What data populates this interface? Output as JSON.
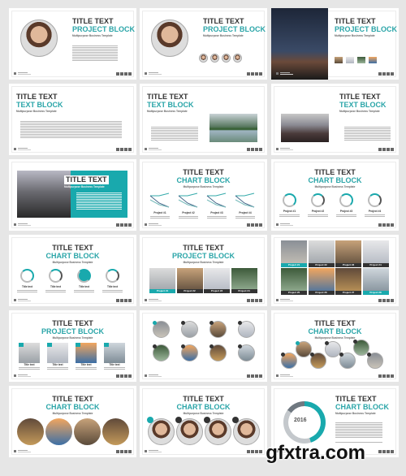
{
  "slides": [
    {
      "title": "TITLE TEXT",
      "subtitle": "PROJECT BLOCK",
      "tagline": "Multipurpose Business Template"
    },
    {
      "title": "TITLE TEXT",
      "subtitle": "PROJECT BLOCK",
      "tagline": "Multipurpose Business Template"
    },
    {
      "title": "TITLE TEXT",
      "subtitle": "PROJECT BLOCK",
      "tagline": "Multipurpose Business Template"
    },
    {
      "title": "TITLE TEXT",
      "subtitle": "TEXT BLOCK",
      "tagline": "Multipurpose Business Template"
    },
    {
      "title": "TITLE TEXT",
      "subtitle": "TEXT BLOCK",
      "tagline": "Multipurpose Business Template"
    },
    {
      "title": "TITLE TEXT",
      "subtitle": "TEXT BLOCK",
      "tagline": "Multipurpose Business Template"
    },
    {
      "title": "TITLE TEXT",
      "tagline": "Multipurpose Business Template"
    },
    {
      "title": "TITLE TEXT",
      "subtitle": "CHART BLOCK",
      "tagline": "Multipurpose Business Template",
      "items": [
        "Project #1",
        "Project #2",
        "Project #3",
        "Project #4"
      ]
    },
    {
      "title": "TITLE TEXT",
      "subtitle": "CHART BLOCK",
      "tagline": "Multipurpose Business Template",
      "items": [
        "Project #1",
        "Project #2",
        "Project #3",
        "Project #4"
      ]
    },
    {
      "title": "TITLE TEXT",
      "subtitle": "CHART BLOCK",
      "tagline": "Multipurpose Business Template",
      "items": [
        "Title text",
        "Title text",
        "Title text",
        "Title text"
      ]
    },
    {
      "title": "TITLE TEXT",
      "subtitle": "PROJECT BLOCK",
      "tagline": "Multipurpose Business Template",
      "items": [
        "Project #1",
        "Project #2",
        "Project #3",
        "Project #4"
      ]
    },
    {
      "items": [
        "Project #1",
        "Project #2",
        "Project #3",
        "Project #4",
        "Project #5",
        "Project #6",
        "Project #7",
        "Project #8"
      ]
    },
    {
      "title": "TITLE TEXT",
      "subtitle": "PROJECT BLOCK",
      "tagline": "Multipurpose Business Template",
      "items": [
        "Title text",
        "Title text",
        "Title text",
        "Title text"
      ]
    },
    {},
    {
      "title": "TITLE TEXT",
      "subtitle": "CHART BLOCK",
      "tagline": "Multipurpose Business Template"
    },
    {
      "title": "TITLE TEXT",
      "subtitle": "CHART BLOCK",
      "tagline": "Multipurpose Business Template"
    },
    {
      "title": "TITLE TEXT",
      "subtitle": "CHART BLOCK",
      "tagline": "Multipurpose Business Template"
    },
    {
      "title": "TITLE TEXT",
      "subtitle": "CHART BLOCK",
      "tagline": "Multipurpose Business Template",
      "year": "2016",
      "donut_fraction": 0.45
    }
  ],
  "colors": {
    "accent": "#2aa5a8",
    "dark": "#333333",
    "background": "#e6e6e6"
  },
  "watermark": "gfxtra.com"
}
